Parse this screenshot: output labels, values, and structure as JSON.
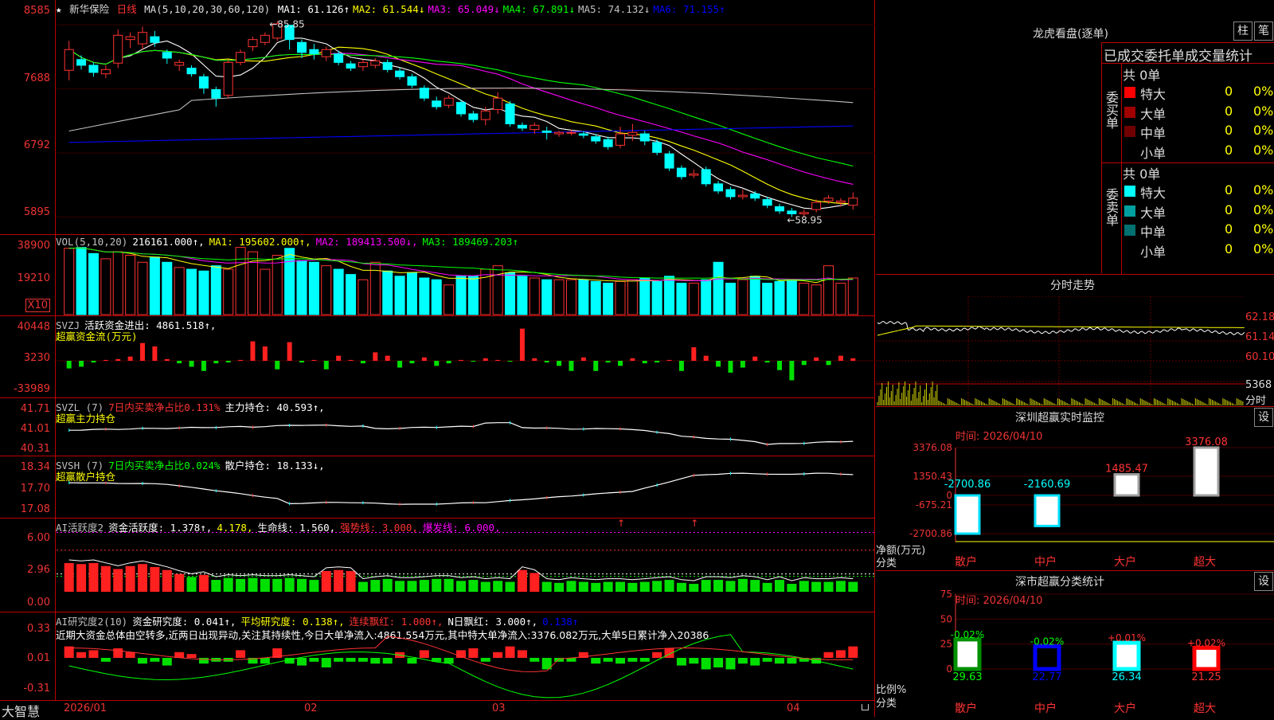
{
  "stock": {
    "star": "★",
    "name": "新华保险",
    "period": "日线"
  },
  "main_pane": {
    "ma_prefix": "MA(5,10,20,30,60,120)",
    "mas": [
      {
        "label": "MA1:",
        "value": "61.126↑",
        "color": "#ffffff"
      },
      {
        "label": "MA2:",
        "value": "61.544↓",
        "color": "#ffff00"
      },
      {
        "label": "MA3:",
        "value": "65.049↓",
        "color": "#ff00ff"
      },
      {
        "label": "MA4:",
        "value": "67.891↓",
        "color": "#00ff00"
      },
      {
        "label": "MA5:",
        "value": "74.132↓",
        "color": "#c0c0c0"
      },
      {
        "label": "MA6:",
        "value": "71.155↑",
        "color": "#0000ff"
      }
    ],
    "y_ticks": [
      "8585",
      "7688",
      "6792",
      "5895"
    ],
    "high_label": "85.85",
    "low_label": "58.95"
  },
  "vol_pane": {
    "header": [
      {
        "text": "VOL(5,10,20)",
        "color": "#c0c0c0"
      },
      {
        "text": "216161.000↑,",
        "color": "#ffffff"
      },
      {
        "text": "MA1: 195602.000↑,",
        "color": "#ffff00"
      },
      {
        "text": "MA2: 189413.500↓,",
        "color": "#ff00ff"
      },
      {
        "text": "MA3: 189469.203↑",
        "color": "#00ff00"
      }
    ],
    "y_ticks": [
      "38900",
      "19210"
    ],
    "unit": "X10"
  },
  "svzj_pane": {
    "header": [
      {
        "text": "SVZJ",
        "color": "#c0c0c0"
      },
      {
        "text": "活跃资金进出: 4861.518↑,",
        "color": "#ffffff"
      }
    ],
    "sub": "超赢资金流(万元)",
    "y_ticks": [
      "40448",
      "3230",
      "-33989"
    ]
  },
  "svzl_pane": {
    "header": [
      {
        "text": "SVZL (7)",
        "color": "#c0c0c0"
      },
      {
        "text": "7日内买卖净占比0.131%",
        "color": "#ff3333"
      },
      {
        "text": "主力持仓: 40.593↑,",
        "color": "#ffffff"
      }
    ],
    "sub": "超赢主力持仓",
    "y_ticks": [
      "41.71",
      "41.01",
      "40.31"
    ]
  },
  "svsh_pane": {
    "header": [
      {
        "text": "SVSH (7)",
        "color": "#c0c0c0"
      },
      {
        "text": "7日内买卖净占比0.024%",
        "color": "#00ff00"
      },
      {
        "text": "散户持仓: 18.133↓,",
        "color": "#ffffff"
      }
    ],
    "sub": "超赢散户持仓",
    "y_ticks": [
      "18.34",
      "17.70",
      "17.08"
    ]
  },
  "ai_active_pane": {
    "header": [
      {
        "text": "AI活跃度2",
        "color": "#c0c0c0"
      },
      {
        "text": "资金活跃度: 1.378↑,",
        "color": "#ffffff"
      },
      {
        "text": "4.178,",
        "color": "#ffff00"
      },
      {
        "text": "生命线: 1.560,",
        "color": "#ffffff"
      },
      {
        "text": "强势线: 3.000,",
        "color": "#ff3333"
      },
      {
        "text": "爆发线: 6.000,",
        "color": "#ff00ff"
      }
    ],
    "y_ticks": [
      "6.00",
      "2.96",
      "0.00"
    ]
  },
  "ai_research_pane": {
    "header": [
      {
        "text": "AI研究度2(10)",
        "color": "#c0c0c0"
      },
      {
        "text": "资金研究度: 0.041↑,",
        "color": "#ffffff"
      },
      {
        "text": "平均研究度: 0.138↑,",
        "color": "#ffff00"
      },
      {
        "text": "连续飘红: 1.000↑,",
        "color": "#ff3333"
      },
      {
        "text": "N日飘红: 3.000↑,",
        "color": "#ffffff"
      },
      {
        "text": "0.138↑",
        "color": "#0000ff"
      }
    ],
    "comment": "近期大资金总体由空转多,近两日出现异动,关注其持续性,今日大单净流入:4861.554万元,其中特大单净流入:3376.082万元,大单5日累计净入20386",
    "y_ticks": [
      "0.33",
      "0.01",
      "-0.31"
    ]
  },
  "x_axis": {
    "brand": "大智慧",
    "labels": [
      "2026/01",
      "02",
      "03",
      "04"
    ]
  },
  "longhu": {
    "title": "龙虎看盘(逐单)",
    "btn_zhu": "柱",
    "btn_bi": "笔",
    "tabs": "已成交委托单成交量统计",
    "buy": {
      "side_label": "委买单",
      "total": "共 0单",
      "rows": [
        {
          "label": "特大",
          "count": "0",
          "pct": "0%",
          "color": "#ff0000"
        },
        {
          "label": "大单",
          "count": "0",
          "pct": "0%",
          "color": "#a00000"
        },
        {
          "label": "中单",
          "count": "0",
          "pct": "0%",
          "color": "#700000"
        },
        {
          "label": "小单",
          "count": "0",
          "pct": "0%",
          "color": "#000000"
        }
      ]
    },
    "sell": {
      "side_label": "委卖单",
      "total": "共 0单",
      "rows": [
        {
          "label": "特大",
          "count": "0",
          "pct": "0%",
          "color": "#00ffff"
        },
        {
          "label": "大单",
          "count": "0",
          "pct": "0%",
          "color": "#00a0a0"
        },
        {
          "label": "中单",
          "count": "0",
          "pct": "0%",
          "color": "#007070"
        },
        {
          "label": "小单",
          "count": "0",
          "pct": "0%",
          "color": "#000000"
        }
      ]
    }
  },
  "intraday": {
    "title": "分时走势",
    "price_ticks": [
      "62.18",
      "61.14",
      "60.10"
    ],
    "vol_tick": "5368",
    "vol_unit": "分时"
  },
  "sz_monitor": {
    "title": "深圳超赢实时监控",
    "settings": "设",
    "time": "时间: 2026/04/10",
    "y_ticks": [
      "3376.08",
      "1350.43",
      "0",
      "-675.21",
      "-2700.86"
    ],
    "y_unit": "净额(万元)",
    "x_title": "分类",
    "categories": [
      "散户",
      "中户",
      "大户",
      "超大"
    ],
    "values": [
      "-2700.86",
      "-2160.69",
      "1485.47",
      "3376.08"
    ]
  },
  "sz_classify": {
    "title": "深市超赢分类统计",
    "settings": "设",
    "time": "时间: 2026/04/10",
    "y_ticks": [
      "75",
      "50",
      "25",
      "0"
    ],
    "y_unit": "比例%",
    "x_title": "分类",
    "categories": [
      "散户",
      "中户",
      "大户",
      "超大"
    ],
    "values": [
      "29.63",
      "22.77",
      "26.34",
      "21.25"
    ],
    "changes": [
      "-0.02%",
      "-0.02%",
      "+0.01%",
      "+0.02%"
    ]
  },
  "chart_data": {
    "type": "candlestick",
    "candles": [
      [
        79.5,
        82.4,
        78.1,
        83.6
      ],
      [
        81.0,
        80.2,
        79.6,
        81.6
      ],
      [
        80.2,
        79.2,
        78.6,
        80.6
      ],
      [
        79.0,
        79.6,
        78.4,
        80.2
      ],
      [
        80.5,
        84.4,
        79.8,
        85.2
      ],
      [
        83.8,
        84.2,
        82.6,
        84.8
      ],
      [
        83.2,
        84.8,
        82.4,
        85.6
      ],
      [
        84.2,
        83.4,
        82.8,
        85.0
      ],
      [
        82.0,
        81.2,
        80.4,
        82.4
      ],
      [
        80.2,
        80.6,
        79.4,
        81.0
      ],
      [
        79.8,
        79.0,
        78.6,
        80.2
      ],
      [
        78.6,
        77.0,
        76.2,
        79.0
      ],
      [
        76.8,
        75.6,
        74.4,
        77.2
      ],
      [
        76.0,
        80.6,
        75.6,
        81.0
      ],
      [
        80.6,
        82.0,
        80.2,
        82.4
      ],
      [
        82.8,
        83.8,
        82.2,
        84.2
      ],
      [
        83.4,
        84.4,
        83.0,
        84.8
      ],
      [
        84.0,
        86.0,
        83.6,
        86.4
      ],
      [
        85.8,
        83.8,
        82.4,
        85.85
      ],
      [
        83.4,
        82.0,
        81.2,
        83.8
      ],
      [
        82.4,
        81.8,
        81.0,
        83.2
      ],
      [
        81.4,
        82.4,
        80.8,
        82.8
      ],
      [
        81.8,
        80.6,
        80.2,
        82.2
      ],
      [
        80.4,
        79.8,
        79.4,
        80.8
      ],
      [
        80.0,
        80.6,
        79.4,
        81.0
      ],
      [
        80.2,
        80.8,
        79.8,
        81.2
      ],
      [
        80.6,
        79.6,
        79.2,
        81.0
      ],
      [
        79.4,
        78.6,
        78.2,
        79.8
      ],
      [
        78.6,
        77.4,
        77.0,
        79.0
      ],
      [
        77.0,
        75.6,
        75.2,
        77.4
      ],
      [
        75.2,
        74.4,
        74.0,
        75.8
      ],
      [
        74.6,
        75.6,
        74.2,
        76.0
      ],
      [
        75.0,
        73.4,
        73.0,
        75.4
      ],
      [
        73.4,
        72.6,
        72.2,
        73.8
      ],
      [
        72.6,
        73.8,
        71.8,
        74.4
      ],
      [
        74.0,
        75.6,
        73.4,
        76.4
      ],
      [
        74.8,
        72.0,
        71.6,
        75.2
      ],
      [
        71.8,
        71.4,
        71.0,
        72.2
      ],
      [
        71.2,
        71.8,
        70.6,
        72.2
      ],
      [
        71.0,
        70.8,
        69.8,
        71.6
      ],
      [
        70.6,
        70.8,
        70.2,
        71.0
      ],
      [
        70.8,
        70.8,
        70.4,
        71.2
      ],
      [
        70.6,
        70.4,
        70.0,
        71.0
      ],
      [
        70.2,
        69.6,
        69.2,
        70.6
      ],
      [
        69.8,
        68.8,
        68.4,
        70.2
      ],
      [
        69.0,
        70.6,
        68.6,
        71.6
      ],
      [
        70.4,
        70.8,
        69.6,
        72.0
      ],
      [
        70.6,
        69.6,
        69.0,
        71.0
      ],
      [
        69.4,
        68.0,
        67.6,
        69.8
      ],
      [
        67.8,
        65.8,
        65.4,
        68.2
      ],
      [
        65.8,
        64.6,
        64.2,
        66.2
      ],
      [
        64.8,
        65.0,
        64.4,
        65.6
      ],
      [
        65.6,
        63.6,
        63.2,
        66.0
      ],
      [
        63.6,
        62.6,
        62.2,
        64.0
      ],
      [
        62.8,
        61.8,
        61.4,
        63.2
      ],
      [
        61.8,
        62.0,
        61.4,
        62.8
      ],
      [
        62.2,
        61.6,
        61.2,
        62.6
      ],
      [
        61.4,
        60.6,
        60.2,
        61.8
      ],
      [
        60.4,
        59.8,
        59.4,
        60.8
      ],
      [
        59.8,
        59.4,
        58.95,
        60.2
      ],
      [
        59.4,
        59.6,
        59.0,
        60.0
      ],
      [
        60.0,
        61.0,
        59.6,
        61.4
      ],
      [
        61.2,
        61.6,
        60.8,
        62.0
      ],
      [
        61.0,
        61.2,
        60.4,
        61.6
      ],
      [
        60.6,
        61.6,
        60.0,
        62.4
      ]
    ],
    "volume": [
      38000,
      38500,
      35000,
      32000,
      36000,
      34000,
      30000,
      33000,
      30000,
      27000,
      26000,
      25000,
      28000,
      26000,
      38500,
      36000,
      26000,
      34000,
      38000,
      31000,
      30000,
      28000,
      26000,
      23000,
      20000,
      30000,
      25000,
      22000,
      24000,
      21000,
      20000,
      17000,
      22000,
      22000,
      26000,
      28000,
      24000,
      22000,
      21000,
      20000,
      20000,
      20000,
      20000,
      19000,
      18000,
      19000,
      20000,
      21000,
      19000,
      22000,
      18000,
      18000,
      20000,
      30000,
      18000,
      20000,
      22000,
      18000,
      19000,
      20000,
      18000,
      17000,
      28000,
      18000,
      21000
    ],
    "svzj": [
      -9000,
      -7000,
      -2000,
      1000,
      2000,
      5000,
      21000,
      17000,
      2000,
      -3000,
      -7000,
      -12000,
      -3000,
      -2000,
      1000,
      23000,
      17000,
      -10000,
      22000,
      -2000,
      1000,
      -10000,
      6000,
      1000,
      -3000,
      10000,
      6000,
      -8000,
      -3000,
      4000,
      -6000,
      -3000,
      1000,
      -1000,
      3000,
      1000,
      -1000,
      38000,
      3000,
      -2000,
      -6000,
      -12000,
      4000,
      -12000,
      -2000,
      -6000,
      3000,
      -3000,
      -2000,
      1000,
      -12000,
      16000,
      6000,
      -7000,
      -14000,
      -8000,
      5000,
      -2000,
      -11000,
      -23000,
      -5000,
      4000,
      -5000,
      6000,
      3000,
      -8000,
      1000,
      -4000,
      -3000,
      -7000,
      18000,
      3000,
      3000
    ],
    "ai_active": [
      2.9,
      2.8,
      2.9,
      2.6,
      2.3,
      2.6,
      2.8,
      2.5,
      2.2,
      1.8,
      1.5,
      1.7,
      1.2,
      1.4,
      1.3,
      1.4,
      1.3,
      1.3,
      1.4,
      1.3,
      1.2,
      2.1,
      2.2,
      2.1,
      1.0,
      1.2,
      1.3,
      1.1,
      1.1,
      1.2,
      1.3,
      1.3,
      1.1,
      1.2,
      1.0,
      1.1,
      1.0,
      2.2,
      1.9,
      1.0,
      0.9,
      1.1,
      1.0,
      0.9,
      1.0,
      1.0,
      0.9,
      1.0,
      1.1,
      1.2,
      0.9,
      0.8,
      1.2,
      1.2,
      1.1,
      1.3,
      1.2,
      0.9,
      1.2,
      0.8,
      1.1,
      1.0,
      1.0,
      1.1,
      1.0,
      0.9,
      1.0,
      1.8,
      1.0,
      1.3
    ]
  }
}
